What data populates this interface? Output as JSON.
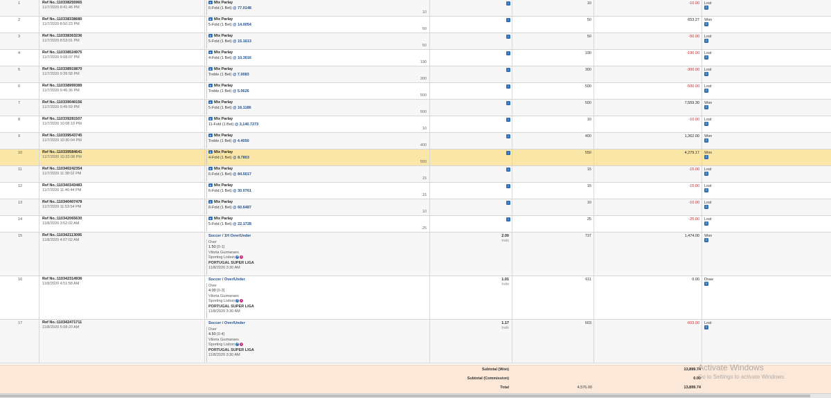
{
  "rows": [
    {
      "no": "1",
      "ref": "Ref No.:110338255965",
      "date": "11/7/2020 8:41:46 PM",
      "kind": "parlay",
      "sel_title": "Mix Parlay",
      "fold": "6-Fold (1 Bet)",
      "odds": "77.0148",
      "sel_stake": "10",
      "stake": "10",
      "winlost": "-10.00",
      "status": "Lost"
    },
    {
      "no": "2",
      "ref": "Ref No.:110338338680",
      "date": "11/7/2020 8:50:23 PM",
      "kind": "parlay",
      "sel_title": "Mix Parlay",
      "fold": "5-Fold (1 Bet)",
      "odds": "14.0054",
      "sel_stake": "50",
      "stake": "50",
      "winlost": "653.27",
      "status": "Won"
    },
    {
      "no": "3",
      "ref": "Ref No.:110338363236",
      "date": "11/7/2020 8:53:01 PM",
      "kind": "parlay",
      "sel_title": "Mix Parlay",
      "fold": "5-Fold (1 Bet)",
      "odds": "15.1613",
      "sel_stake": "50",
      "stake": "50",
      "winlost": "-50.00",
      "status": "Lost"
    },
    {
      "no": "4",
      "ref": "Ref No.:110338524975",
      "date": "11/7/2020 9:08:07 PM",
      "kind": "parlay",
      "sel_title": "Mix Parlay",
      "fold": "4-Fold (1 Bet)",
      "odds": "10.3016",
      "sel_stake": "190",
      "stake": "190",
      "winlost": "-190.00",
      "status": "Lost"
    },
    {
      "no": "5",
      "ref": "Ref No.:110338919870",
      "date": "11/7/2020 9:39:58 PM",
      "kind": "parlay",
      "sel_title": "Mix Parlay",
      "fold": "Treble (1 Bet)",
      "odds": "7.0083",
      "sel_stake": "300",
      "stake": "300",
      "winlost": "-300.00",
      "status": "Lost"
    },
    {
      "no": "6",
      "ref": "Ref No.:110338999389",
      "date": "11/7/2020 9:46:36 PM",
      "kind": "parlay",
      "sel_title": "Mix Parlay",
      "fold": "Treble (1 Bet)",
      "odds": "5.0626",
      "sel_stake": "500",
      "stake": "500",
      "winlost": "-500.00",
      "status": "Lost"
    },
    {
      "no": "7",
      "ref": "Ref No.:110339040156",
      "date": "11/7/2020 9:49:59 PM",
      "kind": "parlay",
      "sel_title": "Mix Parlay",
      "fold": "5-Fold (1 Bet)",
      "odds": "16.1186",
      "sel_stake": "500",
      "stake": "500",
      "winlost": "7,559.30",
      "status": "Won"
    },
    {
      "no": "8",
      "ref": "Ref No.:110339281507",
      "date": "11/7/2020 10:08:10 PM",
      "kind": "parlay",
      "sel_title": "Mix Parlay",
      "fold": "11-Fold (1 Bet)",
      "odds": "3,140.7273",
      "sel_stake": "10",
      "stake": "10",
      "winlost": "-10.00",
      "status": "Lost"
    },
    {
      "no": "9",
      "ref": "Ref No.:110339543745",
      "date": "11/7/2020 10:30:04 PM",
      "kind": "parlay",
      "sel_title": "Mix Parlay",
      "fold": "Treble (1 Bet)",
      "odds": "4.4050",
      "sel_stake": "400",
      "stake": "400",
      "winlost": "1,362.00",
      "status": "Won"
    },
    {
      "no": "10",
      "ref": "Ref No.:110339584641",
      "date": "11/7/2020 10:33:08 PM",
      "kind": "parlay",
      "sel_title": "Mix Parlay",
      "fold": "4-Fold (1 Bet)",
      "odds": "8.7803",
      "sel_stake": "550",
      "stake": "550",
      "winlost": "4,279.17",
      "status": "Won",
      "highlight": true
    },
    {
      "no": "11",
      "ref": "Ref No.:110340242354",
      "date": "11/7/2020 11:38:02 PM",
      "kind": "parlay",
      "sel_title": "Mix Parlay",
      "fold": "6-Fold (1 Bet)",
      "odds": "84.5017",
      "sel_stake": "15",
      "stake": "15",
      "winlost": "-15.00",
      "status": "Lost"
    },
    {
      "no": "12",
      "ref": "Ref No.:110340343483",
      "date": "11/7/2020 11:46:44 PM",
      "kind": "parlay",
      "sel_title": "Mix Parlay",
      "fold": "6-Fold (1 Bet)",
      "odds": "30.0761",
      "sel_stake": "15",
      "stake": "15",
      "winlost": "-15.00",
      "status": "Lost"
    },
    {
      "no": "13",
      "ref": "Ref No.:110340407478",
      "date": "11/7/2020 11:53:54 PM",
      "kind": "parlay",
      "sel_title": "Mix Parlay",
      "fold": "8-Fold (1 Bet)",
      "odds": "60.6487",
      "sel_stake": "10",
      "stake": "10",
      "winlost": "-10.00",
      "status": "Lost"
    },
    {
      "no": "14",
      "ref": "Ref No.:110342065630",
      "date": "11/8/2020 3:52:02 AM",
      "kind": "parlay",
      "sel_title": "Mix Parlay",
      "fold": "5-Fold (1 Bet)",
      "odds": "22.1728",
      "sel_stake": "25",
      "stake": "25",
      "winlost": "-25.00",
      "status": "Lost"
    },
    {
      "no": "15",
      "ref": "Ref No.:110342113095",
      "date": "11/8/2020 4:07:02 AM",
      "kind": "soccer",
      "sel_title": "Soccer / 1H Over/Under",
      "pick": "Over",
      "line": "1.50",
      "score": "[0-1]",
      "home": "Vitoria Guimaraes",
      "away": "Sporting Lisbon",
      "league": "PORTUGAL SUPER LIGA",
      "kickoff": "11/8/2020 3:30 AM",
      "odds": "2.00",
      "odds_type": "Indo",
      "stake": "737",
      "winlost": "1,474.00",
      "status": "Won"
    },
    {
      "no": "16",
      "ref": "Ref No.:110342314936",
      "date": "11/8/2020 4:51:58 AM",
      "kind": "soccer",
      "sel_title": "Soccer / Over/Under",
      "pick": "Over",
      "line": "4.00",
      "score": "[0-3]",
      "home": "Vitoria Guimaraes",
      "away": "Sporting Lisbon",
      "league": "PORTUGAL SUPER LIGA",
      "kickoff": "11/8/2020 3:30 AM",
      "odds": "1.01",
      "odds_type": "Indo",
      "stake": "611",
      "winlost": "0.00",
      "status": "Draw"
    },
    {
      "no": "17",
      "ref": "Ref No.:110342471711",
      "date": "11/8/2020 5:08:20 AM",
      "kind": "soccer",
      "sel_title": "Soccer / Over/Under",
      "pick": "Over",
      "line": "4.50",
      "score": "[0-4]",
      "home": "Vitoria Guimaraes",
      "away": "Sporting Lisbon",
      "league": "PORTUGAL SUPER LIGA",
      "kickoff": "11/8/2020 3:30 AM",
      "odds": "1.17",
      "odds_type": "Indo",
      "stake": "603",
      "winlost": "-603.00",
      "status": "Lost"
    }
  ],
  "footer": {
    "subtotal_won_label": "Subtotal (Won)",
    "subtotal_won_value": "13,899.74",
    "subtotal_comm_label": "Subtotal (Commission)",
    "subtotal_comm_value": "0.00",
    "total_label": "Total",
    "total_stake": "4,576.00",
    "total_value": "13,899.74"
  },
  "watermark": {
    "line1": "Activate Windows",
    "line2": "Go to Settings to activate Windows."
  },
  "icons": {
    "info": "i",
    "status": "receipt-icon",
    "parlay": "arrow-right-icon"
  },
  "colors": {
    "highlight_row": "#fae6a6",
    "negative": "#d21f1f",
    "footer_bg": "#fce8d9",
    "link_blue": "#1f4f90"
  }
}
